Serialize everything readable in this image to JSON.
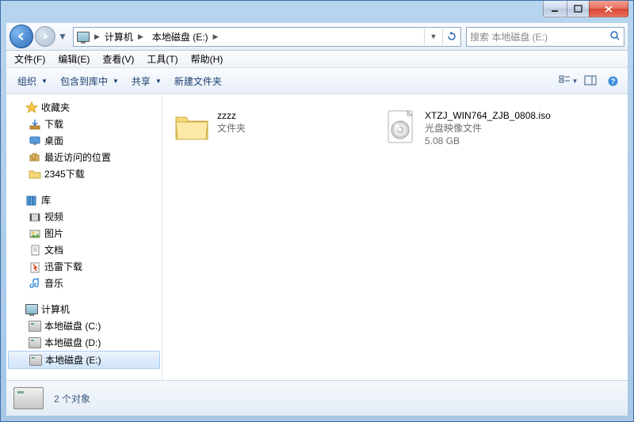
{
  "titlebar": {
    "min": "minimize",
    "max": "maximize",
    "close": "close"
  },
  "nav": {
    "breadcrumb": [
      {
        "icon": "computer",
        "label": "计算机"
      },
      {
        "label": "本地磁盘 (E:)"
      }
    ],
    "search_placeholder": "搜索 本地磁盘 (E:)"
  },
  "menu": {
    "items": [
      "文件(F)",
      "编辑(E)",
      "查看(V)",
      "工具(T)",
      "帮助(H)"
    ]
  },
  "toolbar": {
    "organize": "组织",
    "include": "包含到库中",
    "share": "共享",
    "newfolder": "新建文件夹"
  },
  "sidebar": {
    "favorites": {
      "label": "收藏夹",
      "items": [
        {
          "icon": "download",
          "label": "下载"
        },
        {
          "icon": "desktop",
          "label": "桌面"
        },
        {
          "icon": "recent",
          "label": "最近访问的位置"
        },
        {
          "icon": "2345",
          "label": "2345下载"
        }
      ]
    },
    "libraries": {
      "label": "库",
      "items": [
        {
          "icon": "video",
          "label": "视频"
        },
        {
          "icon": "pictures",
          "label": "图片"
        },
        {
          "icon": "documents",
          "label": "文档"
        },
        {
          "icon": "xunlei",
          "label": "迅雷下载"
        },
        {
          "icon": "music",
          "label": "音乐"
        }
      ]
    },
    "computer": {
      "label": "计算机",
      "items": [
        {
          "icon": "drive",
          "label": "本地磁盘 (C:)",
          "sel": false
        },
        {
          "icon": "drive",
          "label": "本地磁盘 (D:)",
          "sel": false
        },
        {
          "icon": "drive",
          "label": "本地磁盘 (E:)",
          "sel": true
        }
      ]
    }
  },
  "files": [
    {
      "kind": "folder",
      "name": "zzzz",
      "type": "文件夹",
      "size": ""
    },
    {
      "kind": "iso",
      "name": "XTZJ_WIN764_ZJB_0808.iso",
      "type": "光盘映像文件",
      "size": "5.08 GB"
    }
  ],
  "status": {
    "text": "2 个对象"
  }
}
